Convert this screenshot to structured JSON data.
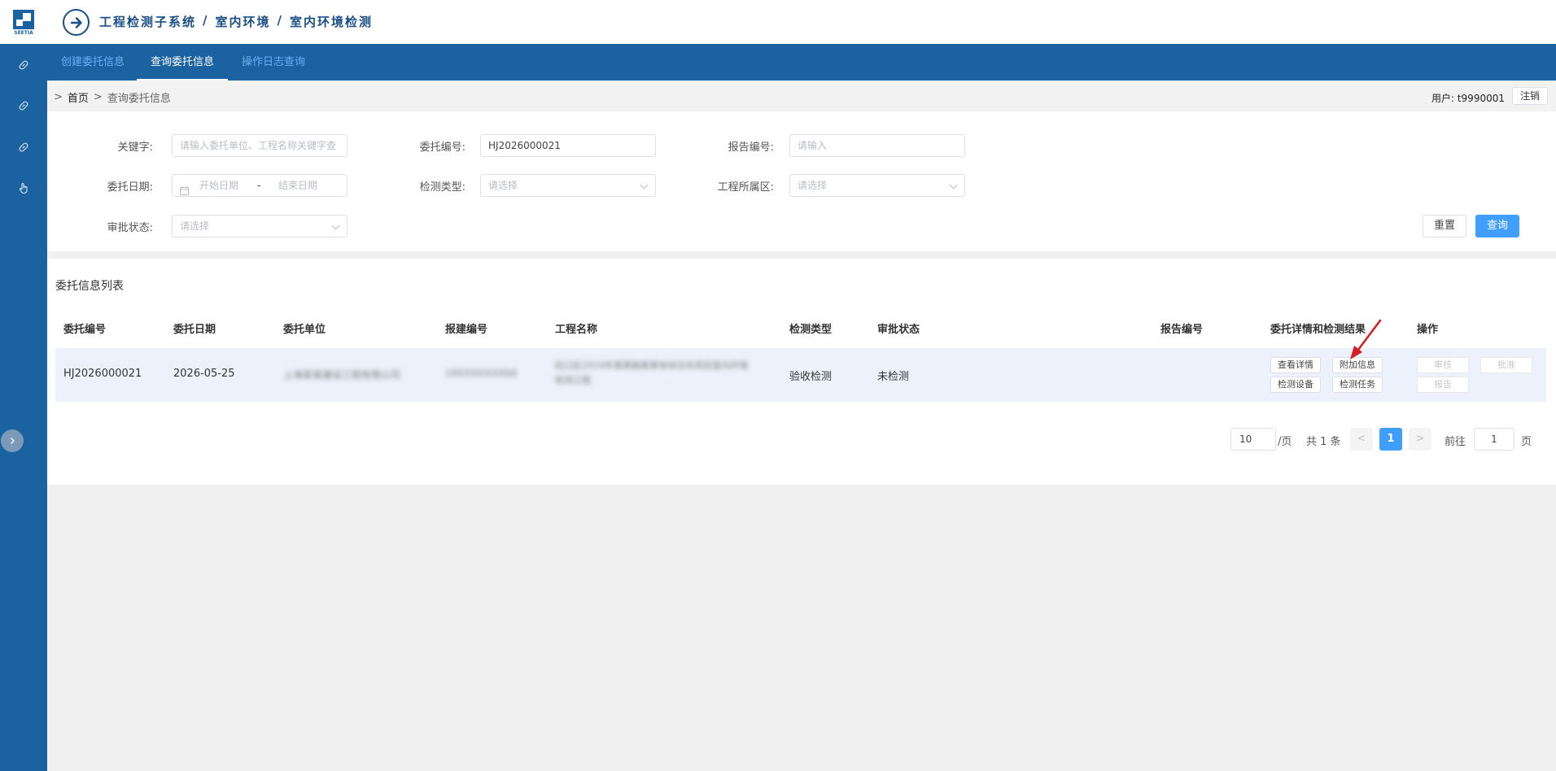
{
  "header": {
    "logo_text": "SEETIA",
    "crumbs": [
      "工程检测子系统",
      "/",
      "室内环境",
      "/",
      "室内环境检测"
    ]
  },
  "tabs": [
    {
      "label": "创建委托信息"
    },
    {
      "label": "查询委托信息"
    },
    {
      "label": "操作日志查询"
    }
  ],
  "breadcrumb": {
    "sep": ">",
    "home": "首页",
    "current": "查询委托信息"
  },
  "user": {
    "label": "用户: t9990001",
    "logout": "注销"
  },
  "filters": {
    "keyword_label": "关键字:",
    "keyword_placeholder": "请输入委托单位、工程名称关键字查",
    "entrust_no_label": "委托编号:",
    "entrust_no_value": "HJ2026000021",
    "report_no_label": "报告编号:",
    "report_no_placeholder": "请输入",
    "entrust_date_label": "委托日期:",
    "start_date_placeholder": "开始日期",
    "date_sep": "-",
    "end_date_placeholder": "结束日期",
    "test_type_label": "检测类型:",
    "test_type_placeholder": "请选择",
    "district_label": "工程所属区:",
    "district_placeholder": "请选择",
    "approval_label": "审批状态:",
    "approval_placeholder": "请选择",
    "reset": "重置",
    "search": "查询"
  },
  "list": {
    "title": "委托信息列表",
    "columns": [
      "委托编号",
      "委托日期",
      "委托单位",
      "报建编号",
      "工程名称",
      "检测类型",
      "审批状态",
      "报告编号",
      "委托详情和检测结果",
      "操作"
    ],
    "row": {
      "entrust_no": "HJ2026000021",
      "date": "2026-05-25",
      "unit": "上海某某建设工程有限公司",
      "build_no": "19XXXXXXX04",
      "project_line1": "虹口区2019年某某路某某地块住宅项目室内环境",
      "project_line2": "检测工程",
      "test_type": "验收检测",
      "approval": "未检测",
      "report_no": "",
      "detail_btns": [
        "查看详情",
        "附加信息",
        "检测设备",
        "检测任务"
      ],
      "op_btns": [
        "审核",
        "批准",
        "报告"
      ]
    }
  },
  "pagination": {
    "page_size": "10",
    "per_page": "/页",
    "total": "共 1 条",
    "prev": "<",
    "current": "1",
    "next": ">",
    "goto_label": "前往",
    "goto_value": "1",
    "page_unit": "页"
  },
  "colors": {
    "primary_blue": "#1a62a0",
    "accent": "#409eff",
    "arrow_red": "#d42020"
  }
}
